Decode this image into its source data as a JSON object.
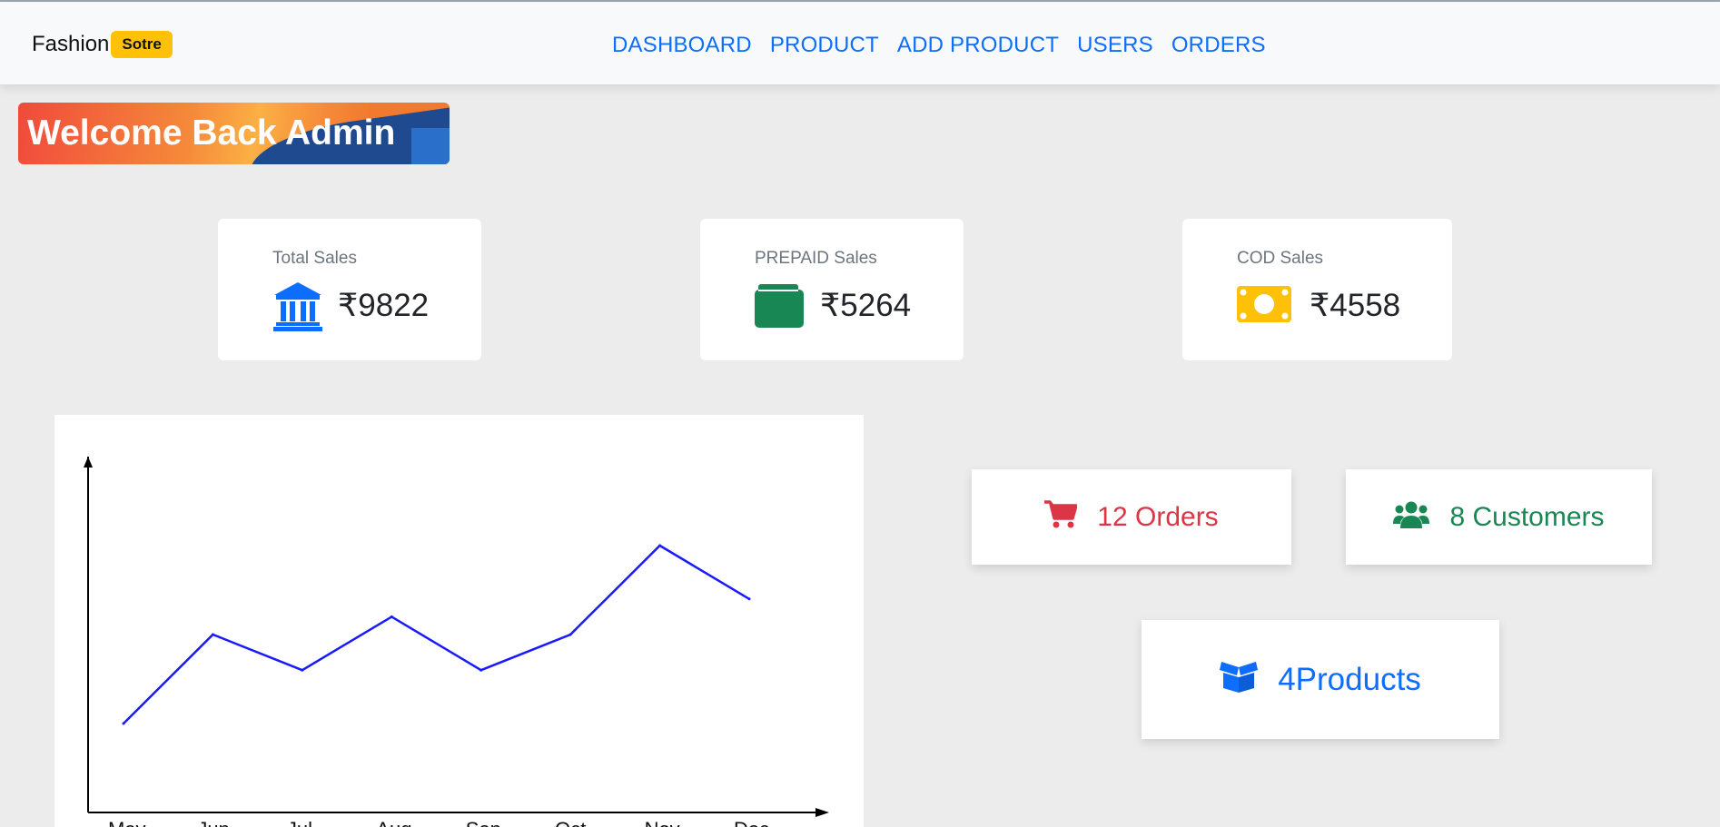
{
  "navbar": {
    "brand_name": "Fashion",
    "brand_badge": "Sotre",
    "links": [
      "DASHBOARD",
      "PRODUCT",
      "ADD PRODUCT",
      "USERS",
      "ORDERS"
    ]
  },
  "banner": {
    "title": "Welcome Back Admin"
  },
  "stats": [
    {
      "label": "Total Sales",
      "value": "₹9822",
      "icon": "bank-icon",
      "color": "#0d6efd"
    },
    {
      "label": "PREPAID Sales",
      "value": "₹5264",
      "icon": "wallet-icon",
      "color": "#198754"
    },
    {
      "label": "COD Sales",
      "value": "₹4558",
      "icon": "cash-icon",
      "color": "#ffc107"
    }
  ],
  "summary": {
    "orders": {
      "text": "12 Orders",
      "icon": "cart-icon",
      "color": "#dc3545"
    },
    "customers": {
      "text": "8 Customers",
      "icon": "users-icon",
      "color": "#198754"
    },
    "products": {
      "text": "4Products",
      "icon": "box-icon",
      "color": "#0d6efd"
    }
  },
  "chart_data": {
    "type": "line",
    "categories": [
      "May",
      "Jun",
      "Jul",
      "Aug",
      "Sep",
      "Oct",
      "Nov",
      "Dec"
    ],
    "series": [
      {
        "values": [
          2,
          7,
          5,
          8,
          5,
          7,
          12,
          9
        ]
      }
    ],
    "ylim": [
      -3,
      17
    ],
    "line_color": "#1a1aff",
    "grid": false
  }
}
